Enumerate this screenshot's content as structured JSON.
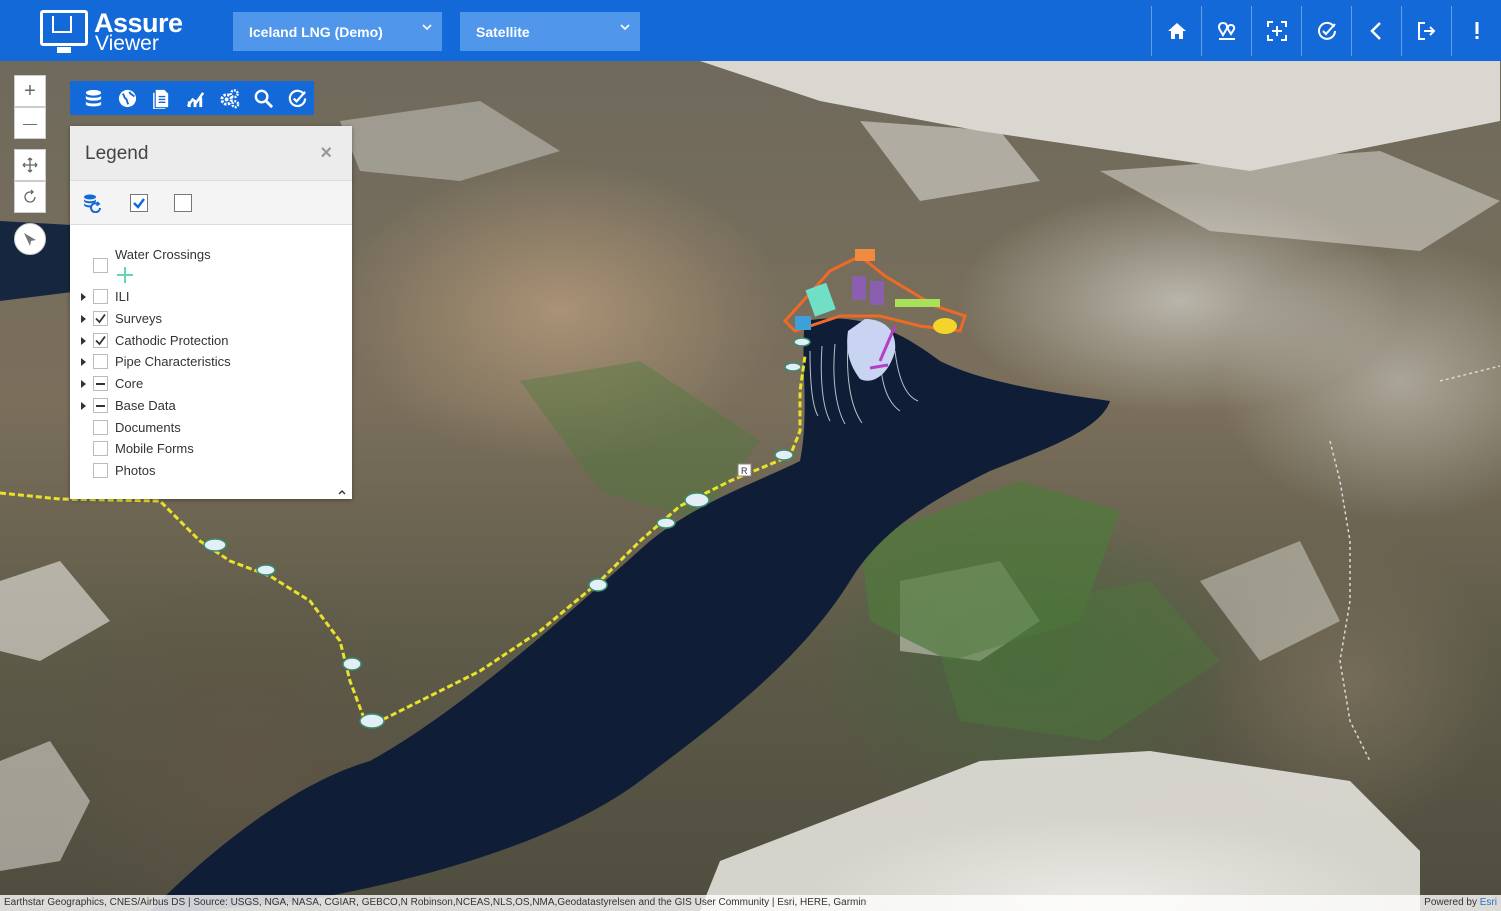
{
  "header": {
    "logo_line1": "Assure",
    "logo_line2": "Viewer",
    "project_select": "Iceland LNG (Demo)",
    "basemap_select": "Satellite",
    "nav_buttons": [
      "home-icon",
      "bookmark-pin-icon",
      "extent-icon",
      "check-icon",
      "back-icon",
      "sign-out-icon",
      "alert-icon"
    ]
  },
  "map_controls": {
    "zoom_in": "+",
    "zoom_out": "—"
  },
  "toolbar": {
    "tools": [
      "database-icon",
      "globe-icon",
      "document-icon",
      "chart-icon",
      "gears-icon",
      "search-icon",
      "check-circle-icon"
    ]
  },
  "legend": {
    "title": "Legend",
    "close": "×",
    "items": [
      {
        "label": "Water Crossings",
        "expandable": false,
        "state": "unchecked"
      },
      {
        "label": "ILI",
        "expandable": true,
        "state": "unchecked"
      },
      {
        "label": "Surveys",
        "expandable": true,
        "state": "checked"
      },
      {
        "label": "Cathodic Protection",
        "expandable": true,
        "state": "checked"
      },
      {
        "label": "Pipe Characteristics",
        "expandable": true,
        "state": "unchecked"
      },
      {
        "label": "Core",
        "expandable": true,
        "state": "partial"
      },
      {
        "label": "Base Data",
        "expandable": true,
        "state": "partial"
      },
      {
        "label": "Documents",
        "expandable": false,
        "state": "unchecked"
      },
      {
        "label": "Mobile Forms",
        "expandable": false,
        "state": "unchecked"
      },
      {
        "label": "Photos",
        "expandable": false,
        "state": "unchecked"
      }
    ]
  },
  "map_labels": {
    "marker": "R"
  },
  "attribution": {
    "text": "Earthstar Geographics, CNES/Airbus DS | Source: USGS, NGA, NASA, CGIAR, GEBCO,N Robinson,NCEAS,NLS,OS,NMA,Geodatastyrelsen and the GIS User Community | Esri, HERE, Garmin",
    "powered_by": "Powered by",
    "powered_by_link": "Esri"
  },
  "colors": {
    "brand_blue": "#1469d8",
    "dropdown_blue": "#5097ec",
    "pipeline_yellow": "#e8e22a"
  }
}
